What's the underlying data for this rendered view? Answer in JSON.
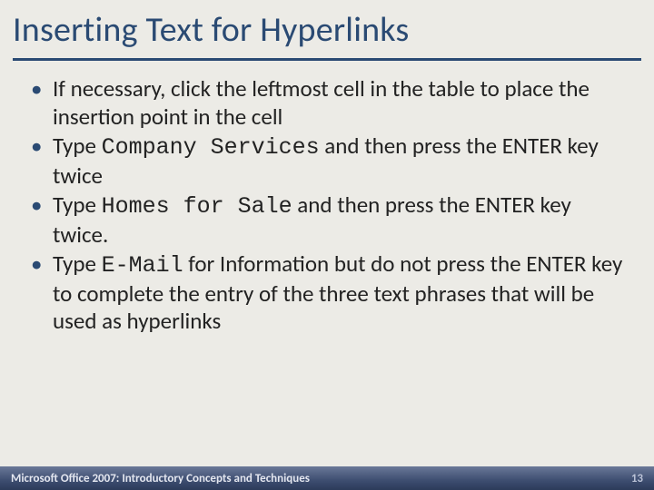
{
  "title": "Inserting Text for Hyperlinks",
  "bullets": [
    {
      "pre": "If necessary, click the leftmost cell in the table to place the insertion point in the cell",
      "code": "",
      "post": ""
    },
    {
      "pre": "Type ",
      "code": "Company Services",
      "post": " and then press the ENTER key twice"
    },
    {
      "pre": "Type ",
      "code": "Homes for Sale",
      "post": " and then press the ENTER key twice."
    },
    {
      "pre": "Type ",
      "code": "E-Mail",
      "post": " for Information but do not press the ENTER key to complete the entry of the three text phrases that will be used as hyperlinks"
    }
  ],
  "footer": {
    "left": "Microsoft Office 2007: Introductory Concepts and Techniques",
    "page": "13"
  }
}
